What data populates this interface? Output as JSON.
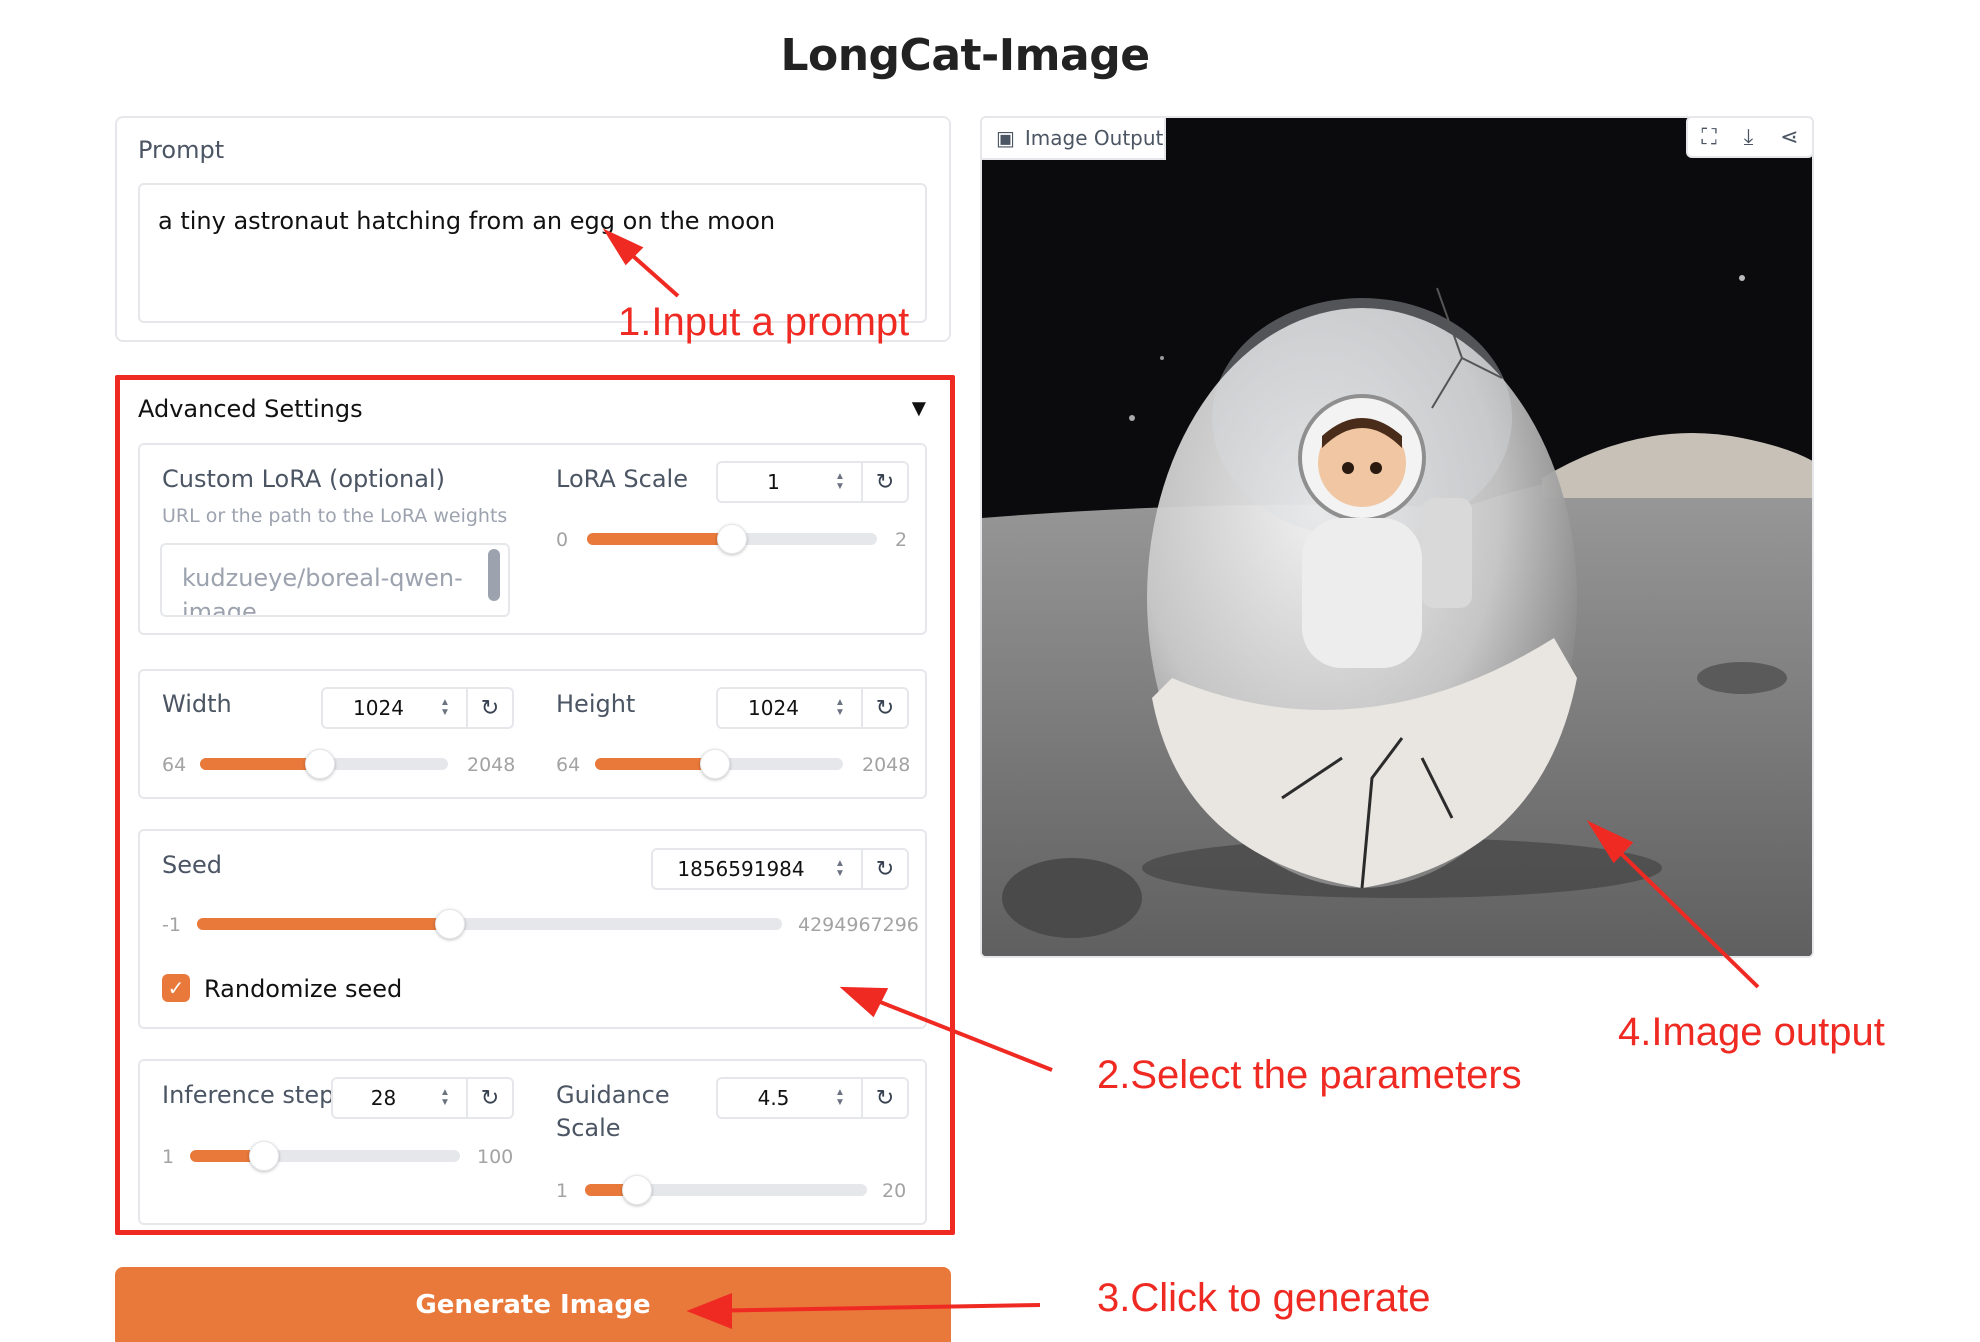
{
  "app_title": "LongCat-Image",
  "prompt": {
    "label": "Prompt",
    "value": "a tiny astronaut hatching from an egg on the moon"
  },
  "advanced": {
    "title": "Advanced Settings",
    "caret": "▼",
    "lora": {
      "label": "Custom LoRA (optional)",
      "info": "URL or the path to the LoRA weights",
      "placeholder": "kudzueye/boreal-qwen-image"
    },
    "lora_scale": {
      "label": "LoRA Scale",
      "value": "1",
      "min": "0",
      "max": "2",
      "fraction": 0.5
    },
    "width": {
      "label": "Width",
      "value": "1024",
      "min": "64",
      "max": "2048",
      "fraction": 0.484
    },
    "height": {
      "label": "Height",
      "value": "1024",
      "min": "64",
      "max": "2048",
      "fraction": 0.484
    },
    "seed": {
      "label": "Seed",
      "value": "1856591984",
      "min": "-1",
      "max": "4294967296",
      "fraction": 0.432
    },
    "randomize": {
      "label": "Randomize seed",
      "checked": true
    },
    "steps": {
      "label": "Inference steps",
      "value": "28",
      "min": "1",
      "max": "100",
      "fraction": 0.273
    },
    "guidance": {
      "label_line1": "Guidance",
      "label_line2": "Scale",
      "value": "4.5",
      "min": "1",
      "max": "20",
      "fraction": 0.184
    }
  },
  "generate_button": "Generate Image",
  "image_output": {
    "label": "Image Output",
    "tools": [
      "fullscreen-icon",
      "download-icon",
      "share-icon"
    ]
  },
  "annotations": {
    "a1": "1.Input a prompt",
    "a2": "2.Select the parameters",
    "a3": "3.Click to generate",
    "a4": "4.Image output"
  },
  "colors": {
    "accent": "#e8793a",
    "annotation": "#ef2a23"
  }
}
